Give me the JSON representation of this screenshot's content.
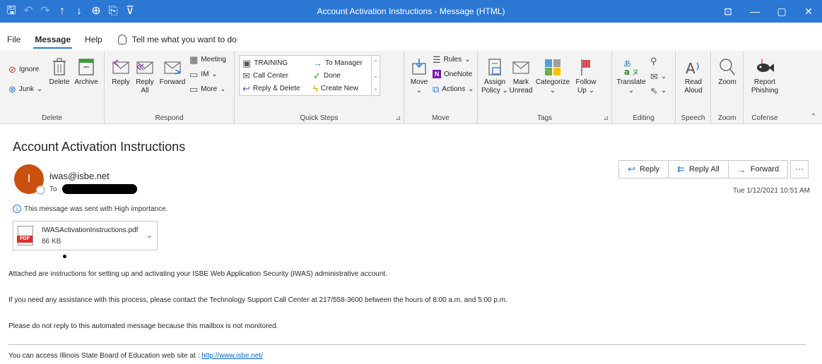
{
  "window": {
    "title": "Account Activation Instructions  -  Message (HTML)",
    "qat_icons": [
      "save-icon",
      "undo-icon",
      "redo-icon",
      "previous-item-icon",
      "next-item-icon",
      "touch-mode-icon",
      "format-icon",
      "customize-qat-icon"
    ],
    "controls": {
      "ribbon_options": "⊡",
      "minimize": "—",
      "maximize": "▢",
      "close": "✕"
    }
  },
  "menu": {
    "tabs": [
      "File",
      "Message",
      "Help"
    ],
    "active_tab": "Message",
    "tell_me": "Tell me what you want to do"
  },
  "ribbon": {
    "delete": {
      "group": "Delete",
      "ignore": "Ignore",
      "junk": "Junk",
      "delete": "Delete",
      "archive": "Archive"
    },
    "respond": {
      "group": "Respond",
      "reply": "Reply",
      "reply_all_1": "Reply",
      "reply_all_2": "All",
      "forward": "Forward",
      "meeting": "Meeting",
      "im": "IM",
      "more": "More"
    },
    "quick_steps": {
      "group": "Quick Steps",
      "items": [
        "TRAINING",
        "To Manager",
        "Call Center",
        "Done",
        "Reply & Delete",
        "Create New"
      ]
    },
    "move": {
      "group": "Move",
      "move": "Move",
      "rules": "Rules",
      "onenote": "OneNote",
      "actions": "Actions"
    },
    "tags": {
      "group": "Tags",
      "assign_1": "Assign",
      "assign_2": "Policy",
      "mark_1": "Mark",
      "mark_2": "Unread",
      "categorize": "Categorize",
      "follow_1": "Follow",
      "follow_2": "Up"
    },
    "editing": {
      "group": "Editing",
      "translate": "Translate"
    },
    "speech": {
      "group": "Speech",
      "read_1": "Read",
      "read_2": "Aloud"
    },
    "zoom": {
      "group": "Zoom",
      "zoom": "Zoom"
    },
    "cofense": {
      "group": "Cofense",
      "report_1": "Report",
      "report_2": "Phishing"
    }
  },
  "message": {
    "subject": "Account Activation Instructions",
    "avatar_initial": "I",
    "sender": "iwas@isbe.net",
    "to_label": "To",
    "importance": "This message was sent with High importance.",
    "attachment": {
      "name": "IWASActivationInstructions.pdf",
      "size": "86 KB",
      "badge": "PDF"
    },
    "actions": {
      "reply": "Reply",
      "reply_all": "Reply All",
      "forward": "Forward",
      "more": "···"
    },
    "datetime": "Tue 1/12/2021 10:51 AM",
    "body": [
      "Attached are instructions for setting up and activating your ISBE Web Application Security (IWAS) administrative account.",
      "If you need any assistance with this process, please contact the Technology Support Call Center at 217/558-3600 between the hours of 8:00 a.m. and 5:00 p.m.",
      "Please do not reply to this automated message because this mailbox is not monitored."
    ],
    "footer_text": "You can access Illinois State Board of Education web site at : ",
    "footer_link": "http://www.isbe.net/"
  }
}
